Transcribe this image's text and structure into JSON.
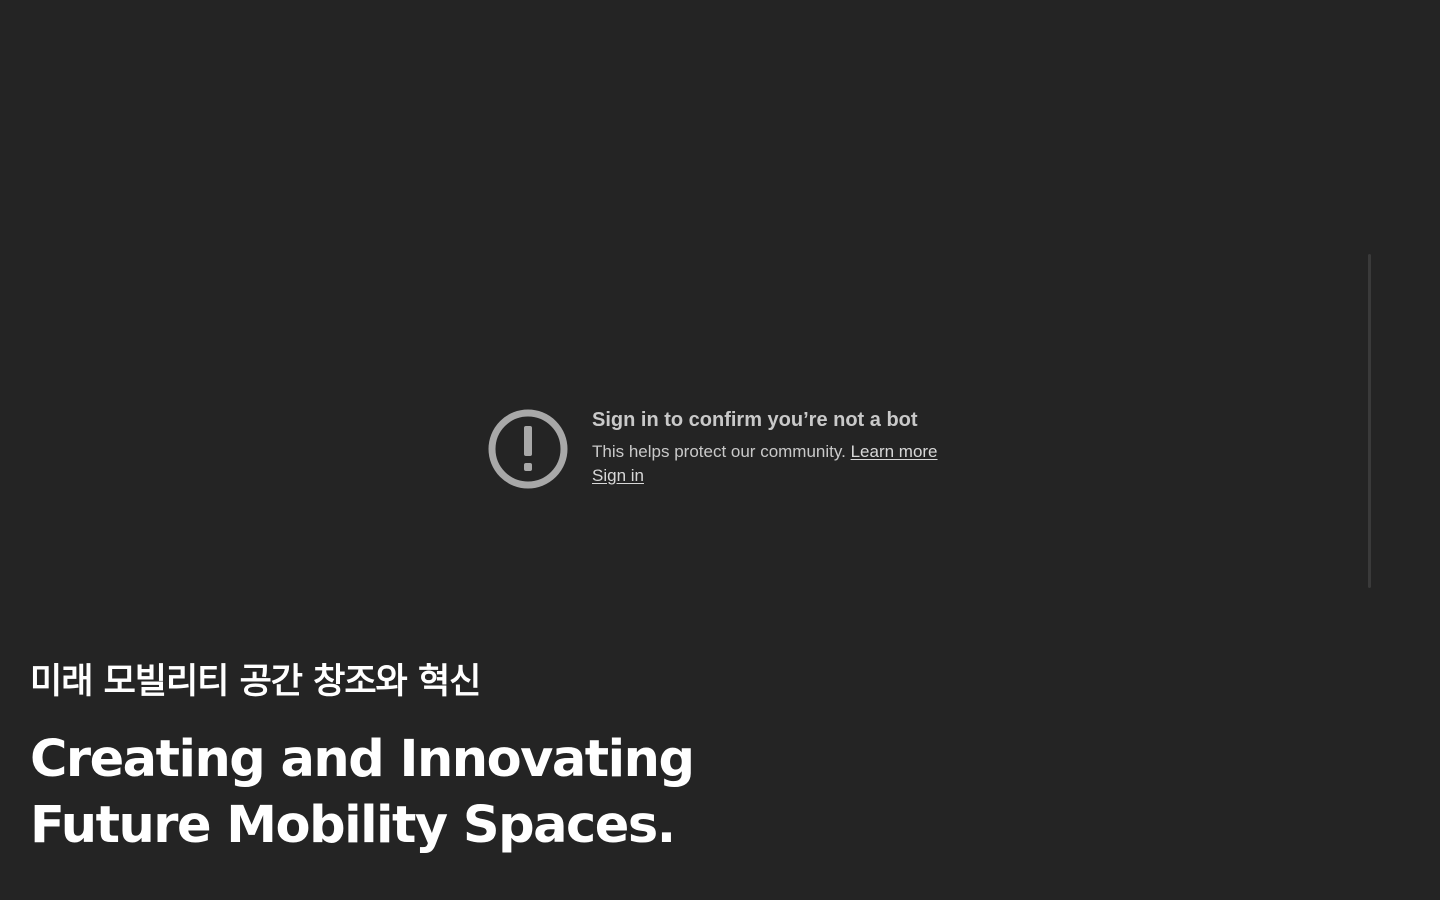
{
  "video": {
    "title": "Sign in to confirm you’re not a bot",
    "description": "This helps protect our community.",
    "learn_more": "Learn more",
    "sign_in": "Sign in",
    "icon": "exclamation-circle-icon"
  },
  "hero": {
    "korean_title": "미래 모빌리티 공간 창조와 혁신",
    "english_line1": "Creating and Innovating",
    "english_line2": "Future Mobility Spaces."
  },
  "colors": {
    "background": "#242424",
    "text_primary": "#ffffff",
    "text_muted": "#c9c9c9",
    "icon": "#a8a8a8"
  }
}
